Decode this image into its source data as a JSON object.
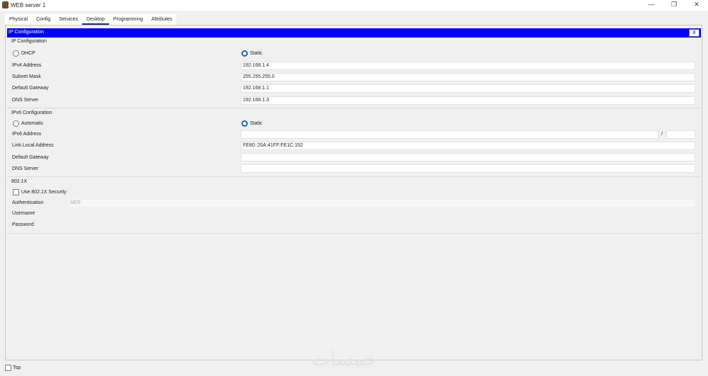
{
  "window": {
    "title": "WEB server 1",
    "minimize": "—",
    "maximize": "❐",
    "close": "✕"
  },
  "tabs": [
    "Physical",
    "Config",
    "Services",
    "Desktop",
    "Programming",
    "Attributes"
  ],
  "active_tab": "Desktop",
  "panel": {
    "header": "IP Configuration",
    "close_label": "X"
  },
  "ipv4": {
    "section": "IP Configuration",
    "dhcp": "DHCP",
    "static": "Static",
    "mode": "Static",
    "fields": [
      {
        "label": "IPv4 Address",
        "value": "192.168.1.4"
      },
      {
        "label": "Subnet Mask",
        "value": "255.255.255.0"
      },
      {
        "label": "Default Gateway",
        "value": "192.168.1.1"
      },
      {
        "label": "DNS Server",
        "value": "192.168.1.3"
      }
    ]
  },
  "ipv6": {
    "section": "IPv6 Configuration",
    "automatic": "Automatic",
    "static": "Static",
    "mode": "Static",
    "address_label": "IPv6 Address",
    "address": "",
    "prefix_sep": "/",
    "prefix": "",
    "fields": [
      {
        "label": "Link Local Address",
        "value": "FE80::20A:41FF:FE1C:152"
      },
      {
        "label": "Default Gateway",
        "value": ""
      },
      {
        "label": "DNS Server",
        "value": ""
      }
    ]
  },
  "dot1x": {
    "section": "802.1X",
    "use_label": "Use 802.1X Security",
    "use": false,
    "auth_label": "Authentication",
    "auth_value": "MD5",
    "username_label": "Username",
    "password_label": "Password"
  },
  "footer": {
    "top_label": "Top"
  },
  "watermark": "خمسات"
}
